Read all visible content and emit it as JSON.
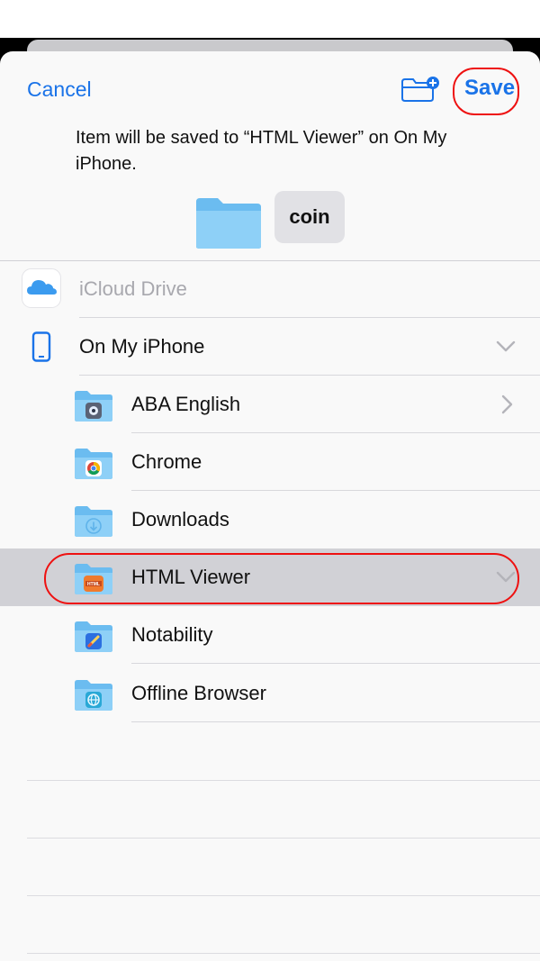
{
  "header": {
    "cancel_label": "Cancel",
    "save_label": "Save",
    "message": "Item will be saved to “HTML Viewer” on On My iPhone.",
    "file_name": "coin"
  },
  "locations": [
    {
      "label": "iCloud Drive",
      "icon": "icloud-icon",
      "state": "disabled"
    },
    {
      "label": "On My iPhone",
      "icon": "iphone-icon",
      "state": "expanded"
    }
  ],
  "folders": [
    {
      "label": "ABA English",
      "icon": "aba-english-app-icon",
      "chevron": "right"
    },
    {
      "label": "Chrome",
      "icon": "chrome-app-icon",
      "chevron": ""
    },
    {
      "label": "Downloads",
      "icon": "download-icon",
      "chevron": ""
    },
    {
      "label": "HTML Viewer",
      "icon": "html-viewer-app-icon",
      "chevron": "down",
      "selected": true
    },
    {
      "label": "Notability",
      "icon": "notability-app-icon",
      "chevron": ""
    },
    {
      "label": "Offline Browser",
      "icon": "offline-browser-app-icon",
      "chevron": ""
    }
  ],
  "colors": {
    "accent": "#1a73e8",
    "highlight_ring": "#ee1111",
    "selected_row": "#d1d1d6",
    "folder": "#7cc5f4"
  }
}
